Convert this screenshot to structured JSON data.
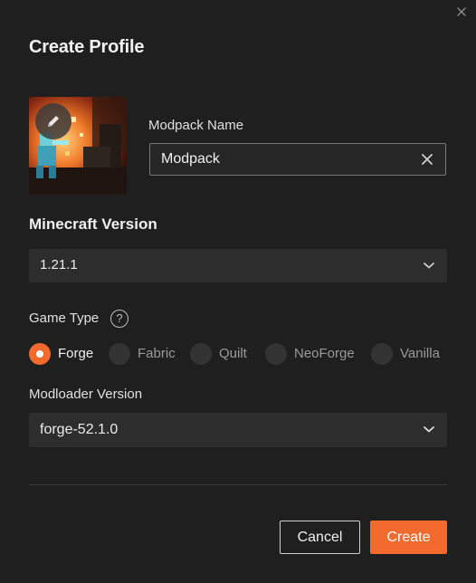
{
  "dialog": {
    "title": "Create Profile",
    "close_icon": "close-icon"
  },
  "modpack": {
    "name_label": "Modpack Name",
    "name_value": "Modpack",
    "clear_icon": "clear-x-icon",
    "image_icon": "pencil-edit-icon"
  },
  "minecraft": {
    "label": "Minecraft Version",
    "selected": "1.21.1"
  },
  "game_type": {
    "label": "Game Type",
    "help": "?",
    "options": [
      {
        "label": "Forge",
        "selected": true
      },
      {
        "label": "Fabric",
        "selected": false
      },
      {
        "label": "Quilt",
        "selected": false
      },
      {
        "label": "NeoForge",
        "selected": false
      },
      {
        "label": "Vanilla",
        "selected": false
      }
    ]
  },
  "modloader": {
    "label": "Modloader Version",
    "selected": "forge-52.1.0"
  },
  "buttons": {
    "cancel": "Cancel",
    "create": "Create"
  },
  "colors": {
    "accent": "#f26a2e",
    "background": "#1f1f1f",
    "field": "#2d2d2d"
  }
}
